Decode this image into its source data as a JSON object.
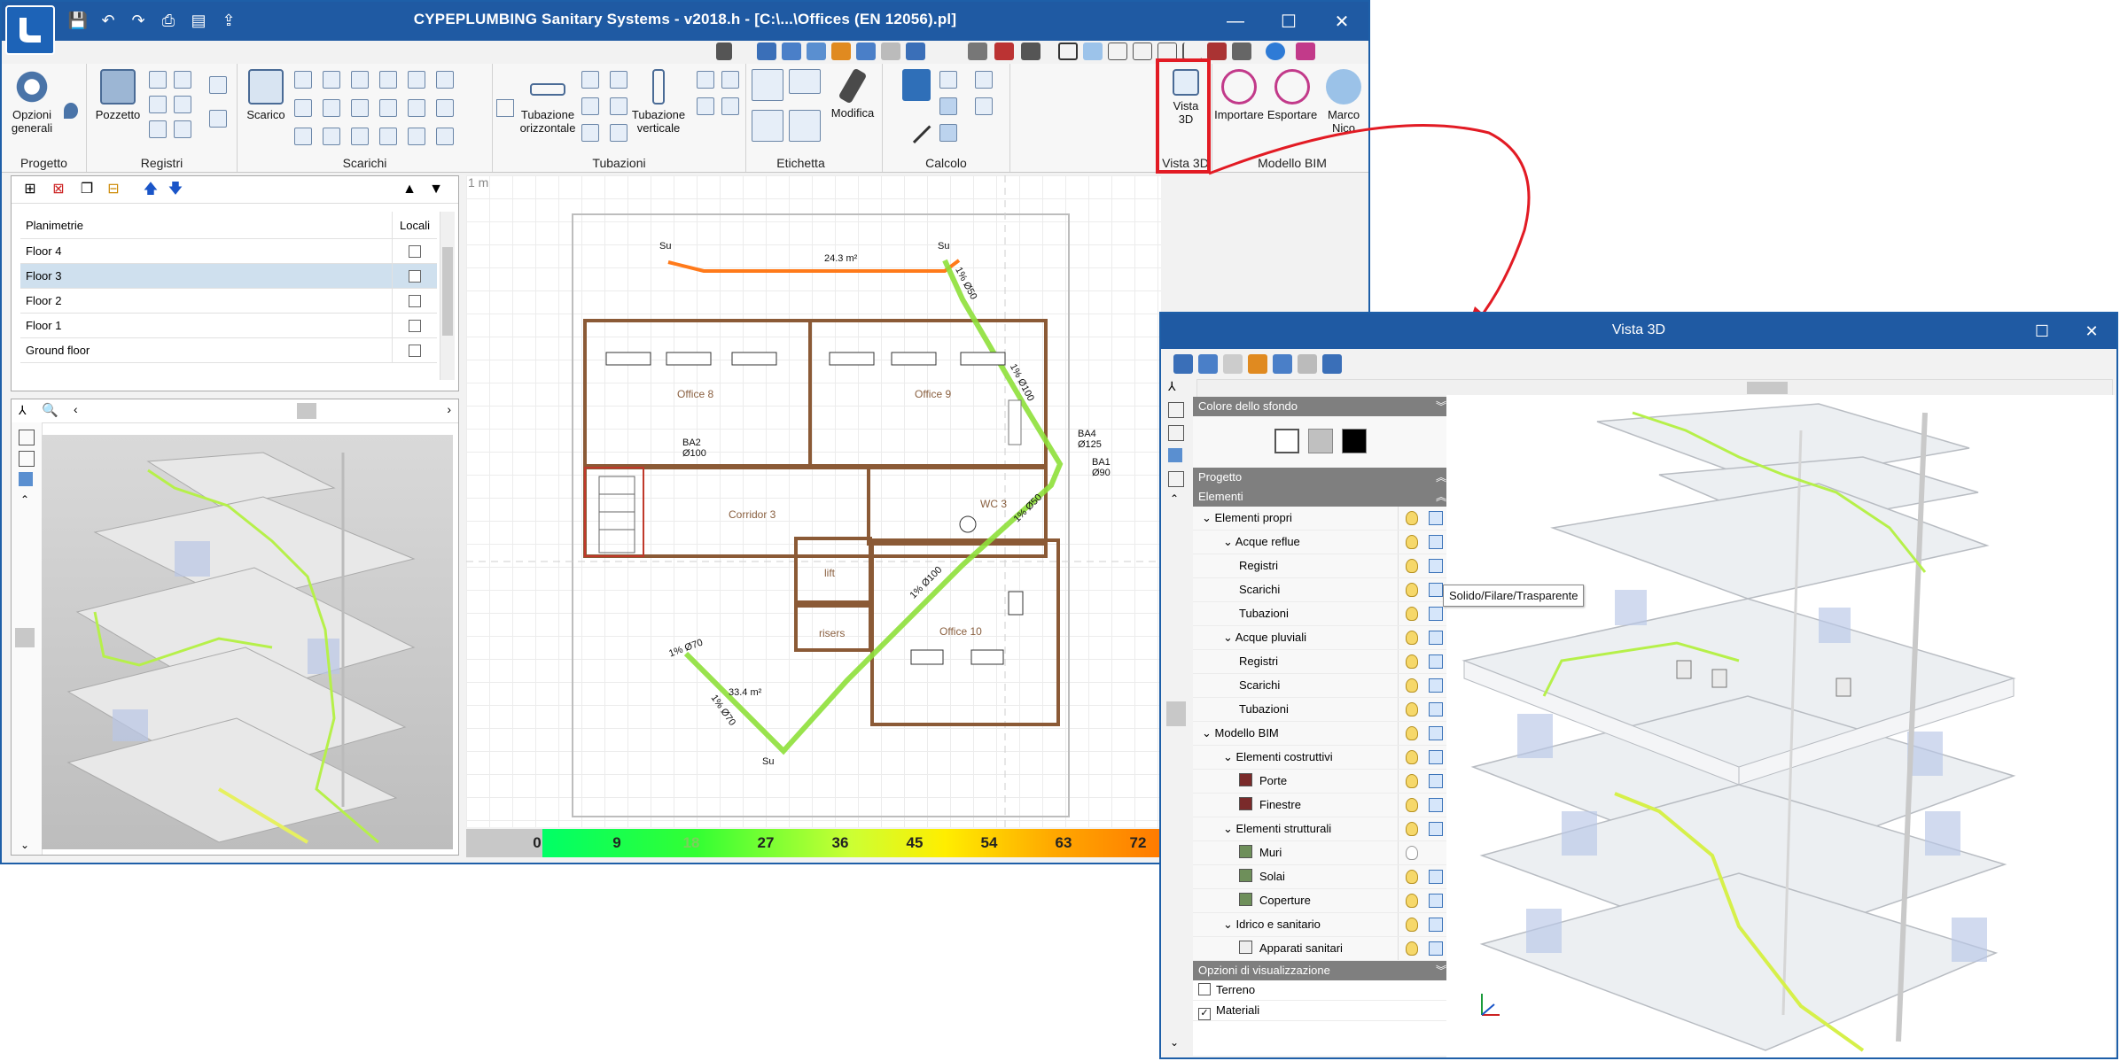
{
  "main_window": {
    "title": "CYPEPLUMBING Sanitary Systems - v2018.h - [C:\\...\\Offices (EN 12056).pl]",
    "controls": {
      "minimize": "—",
      "maximize": "☐",
      "close": "✕"
    }
  },
  "ribbon": {
    "groups": [
      {
        "label": "Progetto",
        "buttons": [
          {
            "label": "Opzioni\ngenerali"
          }
        ]
      },
      {
        "label": "Registri",
        "buttons": [
          {
            "label": "Pozzetto"
          }
        ]
      },
      {
        "label": "Scarichi",
        "buttons": [
          {
            "label": "Scarico"
          }
        ]
      },
      {
        "label": "Tubazioni",
        "buttons": [
          {
            "label": "Tubazione\norizzontale"
          },
          {
            "label": "Tubazione\nverticale"
          }
        ]
      },
      {
        "label": "Etichetta",
        "buttons": [
          {
            "label": "Modifica"
          }
        ]
      },
      {
        "label": "Calcolo",
        "buttons": []
      },
      {
        "label": "Vista 3D",
        "buttons": [
          {
            "label": "Vista\n3D"
          }
        ]
      },
      {
        "label": "Modello BIM",
        "buttons": [
          {
            "label": "Importare"
          },
          {
            "label": "Esportare"
          },
          {
            "label": "Marco\nNico"
          }
        ]
      }
    ]
  },
  "floors_panel": {
    "header": {
      "col1": "Planimetrie",
      "col2": "Locali"
    },
    "rows": [
      {
        "name": "Floor 4",
        "selected": false
      },
      {
        "name": "Floor 3",
        "selected": true
      },
      {
        "name": "Floor 2",
        "selected": false
      },
      {
        "name": "Floor 1",
        "selected": false
      },
      {
        "name": "Ground floor",
        "selected": false
      }
    ]
  },
  "plan": {
    "scale_label": "1 m",
    "rooms": [
      "Office 8",
      "Office 9",
      "Corridor 3",
      "WC 3",
      "lift",
      "risers",
      "Office 10"
    ],
    "pipe_labels": [
      "Su",
      "Su",
      "24.3 m²",
      "1% Ø50",
      "1% Ø100",
      "BA4\nØ125",
      "BA1\nØ90",
      "BA2\nØ100",
      "1% Ø50",
      "1% Ø100",
      "1% Ø70",
      "33.4 m²",
      "1% Ø70",
      "Su"
    ],
    "colorbar_ticks": [
      "0",
      "9",
      "18",
      "27",
      "36",
      "45",
      "54",
      "63",
      "72"
    ]
  },
  "vista3d_window": {
    "title": "Vista 3D",
    "controls": {
      "maximize": "☐",
      "close": "✕"
    },
    "sections": {
      "background": "Colore dello sfondo",
      "project": "Progetto",
      "elements": "Elementi",
      "display_options": "Opzioni di visualizzazione"
    },
    "background_colors": [
      "#ffffff",
      "#c0c0c0",
      "#000000"
    ],
    "tree": [
      {
        "label": "Elementi propri",
        "level": 0,
        "bulb": true
      },
      {
        "label": "Acque reflue",
        "level": 1,
        "bulb": true
      },
      {
        "label": "Registri",
        "level": 2,
        "bulb": true
      },
      {
        "label": "Scarichi",
        "level": 2,
        "bulb": true
      },
      {
        "label": "Tubazioni",
        "level": 2,
        "bulb": true
      },
      {
        "label": "Acque pluviali",
        "level": 1,
        "bulb": true
      },
      {
        "label": "Registri",
        "level": 2,
        "bulb": true
      },
      {
        "label": "Scarichi",
        "level": 2,
        "bulb": true
      },
      {
        "label": "Tubazioni",
        "level": 2,
        "bulb": true
      },
      {
        "label": "Modello BIM",
        "level": 0,
        "bulb": true
      },
      {
        "label": "Elementi costruttivi",
        "level": 1,
        "bulb": true
      },
      {
        "label": "Porte",
        "level": 2,
        "bulb": true,
        "swatch": "#7a2a2a"
      },
      {
        "label": "Finestre",
        "level": 2,
        "bulb": true,
        "swatch": "#7a2a2a"
      },
      {
        "label": "Elementi strutturali",
        "level": 1,
        "bulb": true
      },
      {
        "label": "Muri",
        "level": 2,
        "bulb": false,
        "swatch": "#6e8f5a"
      },
      {
        "label": "Solai",
        "level": 2,
        "bulb": true,
        "swatch": "#6e8f5a"
      },
      {
        "label": "Coperture",
        "level": 2,
        "bulb": true,
        "swatch": "#6e8f5a"
      },
      {
        "label": "Idrico e sanitario",
        "level": 1,
        "bulb": true
      },
      {
        "label": "Apparati sanitari",
        "level": 2,
        "bulb": true,
        "swatch": "#eeeeee"
      }
    ],
    "display_options": [
      {
        "label": "Terreno",
        "checked": false
      },
      {
        "label": "Materiali",
        "checked": true
      }
    ],
    "tooltip": "Solido/Filare/Trasparente"
  },
  "colors": {
    "titlebar": "#1f5aa3",
    "highlight": "#e21b24",
    "pipe_green": "#8ee03a",
    "pipe_orange": "#ff7a1a",
    "wall_brown": "#8b5a36"
  }
}
